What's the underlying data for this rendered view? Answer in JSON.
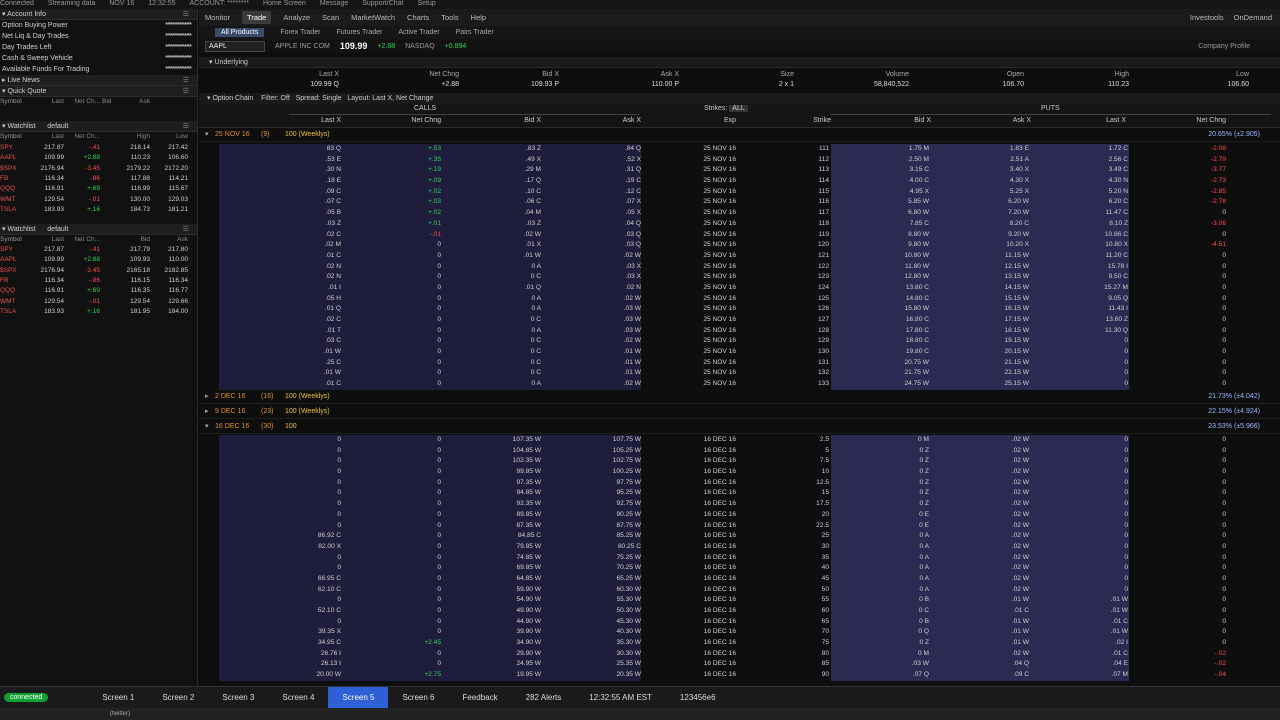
{
  "topbar": [
    "Connected",
    "Streaming data",
    "NOV 16",
    "12:32:55",
    "ACCOUNT: ********",
    "Home Screen",
    "Message",
    "Support/Chat",
    "Setup"
  ],
  "left": {
    "account_title": "Account Info",
    "account_rows": [
      {
        "k": "Option Buying Power",
        "v": "***************"
      },
      {
        "k": "Net Liq & Day Trades",
        "v": "***************"
      },
      {
        "k": "Day Trades Left",
        "v": "***************"
      },
      {
        "k": "Cash & Sweep Vehicle",
        "v": "***************"
      },
      {
        "k": "Available Funds For Trading",
        "v": "***************"
      }
    ],
    "live_news": "Live News",
    "quick_quote": "Quick Quote",
    "qq_cols": [
      "Symbol",
      "Last",
      "Net Ch...",
      "Bid",
      "Ask"
    ],
    "watch1_title": "Watchlist",
    "watch1_name": "default",
    "watch1_cols": [
      "Symbol",
      "Last",
      "Net Ch...",
      "",
      "High",
      "Low"
    ],
    "watch1": [
      [
        "SPY",
        "217.87",
        "-.41",
        "",
        "218.14",
        "217.42"
      ],
      [
        "AAPL",
        "109.99",
        "+2.88",
        "",
        "110.23",
        "106.60"
      ],
      [
        "$SPX",
        "2176.94",
        "-3.45",
        "",
        "2179.22",
        "2172.20"
      ],
      [
        "FB",
        "116.34",
        "-.86",
        "",
        "117.88",
        "114.21"
      ],
      [
        "QQQ",
        "116.91",
        "+.69",
        "",
        "116.99",
        "115.67"
      ],
      [
        "WMT",
        "129.54",
        "-.01",
        "",
        "130.00",
        "129.03"
      ],
      [
        "TSLA",
        "183.93",
        "+.16",
        "",
        "184.73",
        "181.21"
      ]
    ],
    "watch2_title": "Watchlist",
    "watch2_name": "default",
    "watch2_cols": [
      "Symbol",
      "Last",
      "Net Ch...",
      "",
      "Bid",
      "Ask"
    ],
    "watch2": [
      [
        "SPY",
        "217.87",
        "-.41",
        "",
        "217.79",
        "217.80"
      ],
      [
        "AAPL",
        "109.99",
        "+2.88",
        "",
        "109.93",
        "110.00"
      ],
      [
        "$SPX",
        "2176.94",
        "-3.45",
        "",
        "2165.18",
        "2182.85"
      ],
      [
        "FB",
        "116.34",
        "-.86",
        "",
        "116.15",
        "116.34"
      ],
      [
        "QQQ",
        "116.91",
        "+.69",
        "",
        "116.35",
        "116.77"
      ],
      [
        "WMT",
        "129.54",
        "-.01",
        "",
        "129.54",
        "129.66"
      ],
      [
        "TSLA",
        "183.93",
        "+.16",
        "",
        "181.95",
        "184.00"
      ]
    ]
  },
  "tabs": [
    "Monitor",
    "Trade",
    "Analyze",
    "Scan",
    "MarketWatch",
    "Charts",
    "Tools",
    "Help"
  ],
  "tabs_right": [
    "Investools",
    "OnDemand"
  ],
  "subtabs": [
    "All Products",
    "Forex Trader",
    "Futures Trader",
    "Active Trader",
    "Pairs Trader"
  ],
  "symbol": {
    "ticker": "AAPL",
    "name": "APPLE INC COM",
    "price": "109.99",
    "change": "+2.88",
    "exchange": "NASDAQ",
    "change2": "+0.894",
    "company_profile": "Company Profile"
  },
  "underlying": {
    "title": "Underlying",
    "cols": [
      {
        "h": "Last X",
        "v": "109.99 Q"
      },
      {
        "h": "Net Chng",
        "v": "+2.88"
      },
      {
        "h": "Bid X",
        "v": "109.93 P"
      },
      {
        "h": "Ask X",
        "v": "110.00 P"
      },
      {
        "h": "Size",
        "v": "2 x 1"
      },
      {
        "h": "Volume",
        "v": "58,840,522"
      },
      {
        "h": "Open",
        "v": "106.70"
      },
      {
        "h": "High",
        "v": "110.23"
      },
      {
        "h": "Low",
        "v": "106.60"
      }
    ]
  },
  "option_chain": {
    "title": "Option Chain",
    "filter": "Filter: Off",
    "spread": "Spread: Single",
    "layout": "Layout: Last X, Net Change",
    "calls": "CALLS",
    "puts": "PUTS",
    "strikes_label": "Strikes:",
    "strikes_value": "ALL",
    "col_headers": [
      "Last X",
      "Net Chng",
      "Bid X",
      "Ask X",
      "Exp",
      "Strike",
      "Bid X",
      "Ask X",
      "Last X",
      "Net Chng"
    ]
  },
  "expiries": [
    {
      "label": "25 NOV 16",
      "count": "(9)",
      "desc": "100 (Weeklys)",
      "iv": "20.65% (±2.905)"
    },
    {
      "label": "2 DEC 16",
      "count": "(16)",
      "desc": "100 (Weeklys)",
      "iv": "21.73% (±4.042)"
    },
    {
      "label": "9 DEC 16",
      "count": "(23)",
      "desc": "100 (Weeklys)",
      "iv": "22.15% (±4.924)"
    },
    {
      "label": "16 DEC 16",
      "count": "(30)",
      "desc": "100",
      "iv": "23.53% (±5.966)"
    }
  ],
  "chain1": [
    [
      "83 Q",
      "+.53",
      ".83 Z",
      ".84 Q",
      "25 NOV 16",
      "111",
      "1.75 M",
      "1.83 E",
      "1.72 C",
      "-2.08"
    ],
    [
      ".53 E",
      "+.35",
      ".49 X",
      ".52 X",
      "25 NOV 16",
      "112",
      "2.50 M",
      "2.51 A",
      "2.56 C",
      "-2.79"
    ],
    [
      ".30 N",
      "+.19",
      ".29 M",
      ".31 Q",
      "25 NOV 16",
      "113",
      "3.15 C",
      "3.40 X",
      "3.49 C",
      "-3.77"
    ],
    [
      ".18 E",
      "+.09",
      ".17 Q",
      ".19 C",
      "25 NOV 16",
      "114",
      "4.00 C",
      "4.30 X",
      "4.30 N",
      "-2.73"
    ],
    [
      ".09 C",
      "+.02",
      ".10 C",
      ".12 C",
      "25 NOV 16",
      "115",
      "4.95 X",
      "5.25 X",
      "5.20 N",
      "-2.85"
    ],
    [
      ".07 C",
      "+.03",
      ".06 C",
      ".07 X",
      "25 NOV 16",
      "116",
      "5.85 W",
      "6.20 W",
      "6.20 C",
      "-2.78"
    ],
    [
      ".05 B",
      "+.02",
      ".04 M",
      ".05 X",
      "25 NOV 16",
      "117",
      "6.80 W",
      "7.20 W",
      "11.47 C",
      "0"
    ],
    [
      ".03 Z",
      "+.01",
      ".03 Z",
      ".04 Q",
      "25 NOV 16",
      "118",
      "7.85 C",
      "8.20 C",
      "8.10 Z",
      "-3.06"
    ],
    [
      ".02 C",
      "-.01",
      ".02 W",
      ".03 Q",
      "25 NOV 16",
      "119",
      "8.80 W",
      "9.20 W",
      "10.86 C",
      "0"
    ],
    [
      ".02 M",
      "0",
      ".01 X",
      ".03 Q",
      "25 NOV 16",
      "120",
      "9.80 W",
      "10.20 X",
      "10.80 X",
      "-4.51"
    ],
    [
      ".01 C",
      "0",
      ".01 W",
      ".02 W",
      "25 NOV 16",
      "121",
      "10.80 W",
      "11.15 W",
      "11.20 C",
      "0"
    ],
    [
      ".02 N",
      "0",
      "0 A",
      ".03 X",
      "25 NOV 16",
      "122",
      "11.80 W",
      "12.15 W",
      "15.78 I",
      "0"
    ],
    [
      ".02 N",
      "0",
      "0 C",
      ".03 X",
      "25 NOV 16",
      "123",
      "12.80 W",
      "13.15 W",
      "9.50 C",
      "0"
    ],
    [
      ".01 I",
      "0",
      ".01 Q",
      ".02 N",
      "25 NOV 16",
      "124",
      "13.80 C",
      "14.15 W",
      "15.27 M",
      "0"
    ],
    [
      ".05 H",
      "0",
      "0 A",
      ".02 W",
      "25 NOV 16",
      "125",
      "14.80 C",
      "15.15 W",
      "9.05 Q",
      "0"
    ],
    [
      ".01 Q",
      "0",
      "0 A",
      ".03 W",
      "25 NOV 16",
      "126",
      "15.80 W",
      "16.15 W",
      "11.43 I",
      "0"
    ],
    [
      ".02 C",
      "0",
      "0 C",
      ".03 W",
      "25 NOV 16",
      "127",
      "16.80 C",
      "17.15 W",
      "13.60 Z",
      "0"
    ],
    [
      ".01 T",
      "0",
      "0 A",
      ".03 W",
      "25 NOV 16",
      "128",
      "17.80 C",
      "18.15 W",
      "11.30 Q",
      "0"
    ],
    [
      ".03 C",
      "0",
      "0 C",
      ".02 W",
      "25 NOV 16",
      "129",
      "18.80 C",
      "19.15 W",
      "0",
      "0"
    ],
    [
      ".01 W",
      "0",
      "0 C",
      ".01 W",
      "25 NOV 16",
      "130",
      "19.80 C",
      "20.15 W",
      "0",
      "0"
    ],
    [
      ".25 C",
      "0",
      "0 C",
      ".01 W",
      "25 NOV 16",
      "131",
      "20.75 W",
      "21.15 W",
      "0",
      "0"
    ],
    [
      ".01 W",
      "0",
      "0 C",
      ".01 W",
      "25 NOV 16",
      "132",
      "21.75 W",
      "22.15 W",
      "0",
      "0"
    ],
    [
      ".01 C",
      "0",
      "0 A",
      ".02 W",
      "25 NOV 16",
      "133",
      "24.75 W",
      "25.15 W",
      "0",
      "0"
    ]
  ],
  "chain2": [
    [
      "0",
      "0",
      "107.35 W",
      "107.75 W",
      "16 DEC 16",
      "2.5",
      "0 M",
      ".02 W",
      "0",
      "0"
    ],
    [
      "0",
      "0",
      "104.85 W",
      "105.25 W",
      "16 DEC 16",
      "5",
      "0 Z",
      ".02 W",
      "0",
      "0"
    ],
    [
      "0",
      "0",
      "102.35 W",
      "102.75 W",
      "16 DEC 16",
      "7.5",
      "0 Z",
      ".02 W",
      "0",
      "0"
    ],
    [
      "0",
      "0",
      "99.85 W",
      "100.25 W",
      "16 DEC 16",
      "10",
      "0 Z",
      ".02 W",
      "0",
      "0"
    ],
    [
      "0",
      "0",
      "97.35 W",
      "97.75 W",
      "16 DEC 16",
      "12.5",
      "0 Z",
      ".02 W",
      "0",
      "0"
    ],
    [
      "0",
      "0",
      "94.85 W",
      "95.25 W",
      "16 DEC 16",
      "15",
      "0 Z",
      ".02 W",
      "0",
      "0"
    ],
    [
      "0",
      "0",
      "92.35 W",
      "92.75 W",
      "16 DEC 16",
      "17.5",
      "0 Z",
      ".02 W",
      "0",
      "0"
    ],
    [
      "0",
      "0",
      "89.85 W",
      "90.25 W",
      "16 DEC 16",
      "20",
      "0 E",
      ".02 W",
      "0",
      "0"
    ],
    [
      "0",
      "0",
      "87.35 W",
      "87.75 W",
      "16 DEC 16",
      "22.5",
      "0 E",
      ".02 W",
      "0",
      "0"
    ],
    [
      "86.92 C",
      "0",
      "84.85 C",
      "85.25 W",
      "16 DEC 16",
      "25",
      "0 A",
      ".02 W",
      "0",
      "0"
    ],
    [
      "82.00 X",
      "0",
      "79.85 W",
      "80.25 C",
      "16 DEC 16",
      "30",
      "0 A",
      ".02 W",
      "0",
      "0"
    ],
    [
      "0",
      "0",
      "74.85 W",
      "75.25 W",
      "16 DEC 16",
      "35",
      "0 A",
      ".02 W",
      "0",
      "0"
    ],
    [
      "0",
      "0",
      "69.85 W",
      "70.25 W",
      "16 DEC 16",
      "40",
      "0 A",
      ".02 W",
      "0",
      "0"
    ],
    [
      "66.95 C",
      "0",
      "64.85 W",
      "65.25 W",
      "16 DEC 16",
      "45",
      "0 A",
      ".02 W",
      "0",
      "0"
    ],
    [
      "62.10 C",
      "0",
      "59.90 W",
      "60.30 W",
      "16 DEC 16",
      "50",
      "0 A",
      ".02 W",
      "0",
      "0"
    ],
    [
      "0",
      "0",
      "54.90 W",
      "55.30 W",
      "16 DEC 16",
      "55",
      "0 B",
      ".01 W",
      ".01 W",
      "0"
    ],
    [
      "52.10 C",
      "0",
      "49.90 W",
      "50.30 W",
      "16 DEC 16",
      "60",
      "0 C",
      ".01 C",
      ".01 W",
      "0"
    ],
    [
      "0",
      "0",
      "44.90 W",
      "45.30 W",
      "16 DEC 16",
      "65",
      "0 B",
      ".01 W",
      ".01 C",
      "0"
    ],
    [
      "39.35 X",
      "0",
      "39.90 W",
      "40.30 W",
      "16 DEC 16",
      "70",
      "0 Q",
      ".01 W",
      ".01 W",
      "0"
    ],
    [
      "34.95 C",
      "+2.45",
      "34.90 W",
      "35.30 W",
      "16 DEC 16",
      "75",
      "0 Z",
      ".01 W",
      ".02 I",
      "0"
    ],
    [
      "26.76 I",
      "0",
      "29.90 W",
      "30.30 W",
      "16 DEC 16",
      "80",
      "0 M",
      ".02 W",
      ".01 C",
      "-.02"
    ],
    [
      "26.13 I",
      "0",
      "24.95 W",
      "25.35 W",
      "16 DEC 16",
      "85",
      ".03 W",
      ".04 Q",
      ".04 E",
      "-.02"
    ],
    [
      "20.00 W",
      "+2.75",
      "19.95 W",
      "20.35 W",
      "16 DEC 16",
      "90",
      ".07 Q",
      ".09 C",
      ".07 M",
      "-.04"
    ]
  ],
  "bottom": {
    "connected": "connected",
    "screens": [
      "Screen 1",
      "Screen 2",
      "Screen 3",
      "Screen 4",
      "Screen 5",
      "Screen 6"
    ],
    "active_screen": "Screen 5",
    "feedback": "Feedback",
    "alerts": "282 Alerts",
    "time": "12:32:55 AM EST",
    "account": "123456e6",
    "twitter": "(twitter)"
  }
}
